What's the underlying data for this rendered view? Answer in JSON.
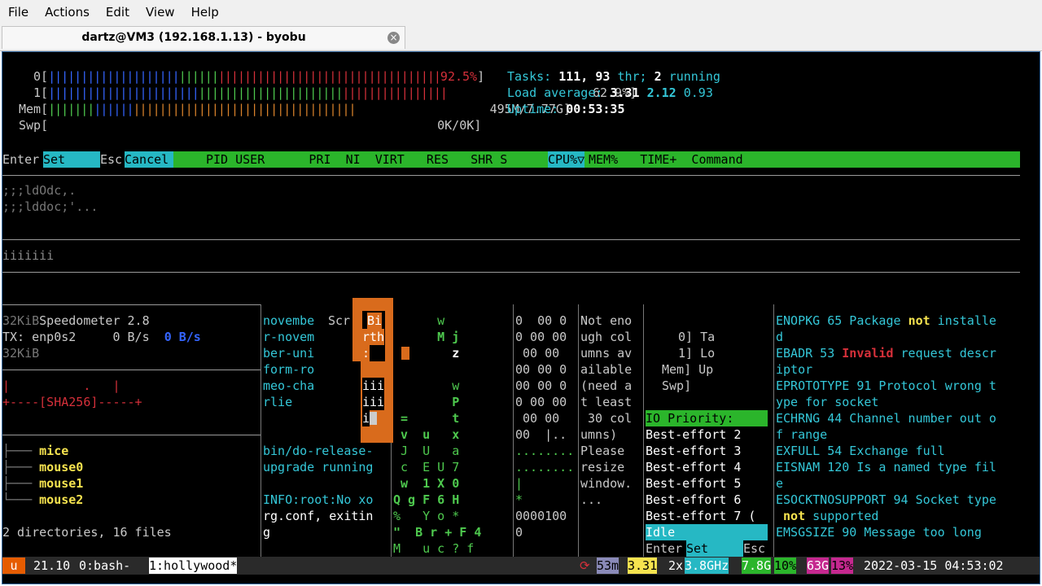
{
  "menu": [
    "File",
    "Actions",
    "Edit",
    "View",
    "Help"
  ],
  "tab": {
    "title": "dartz@VM3 (192.168.1.13) - byobu"
  },
  "htop": {
    "cpu0": {
      "label": "0[",
      "pct": "92.5%",
      "end": "]"
    },
    "cpu1": {
      "label": "1[",
      "pct": "62.9%",
      "end": "]"
    },
    "mem": {
      "label": "Mem[",
      "val": "495M/7.77G",
      "end": "]"
    },
    "swp": {
      "label": "Swp[",
      "val": "0K/0K",
      "end": "]"
    },
    "tasks_label": "Tasks:",
    "tasks_n": "111,",
    "thr_n": "93",
    "thr_label": "thr;",
    "running_n": "2",
    "running_label": "running",
    "load_label": "Load average:",
    "load1": "3.31",
    "load2": "2.12",
    "load3": "0.93",
    "uptime_label": "Uptime:",
    "uptime": "00:53:35",
    "header_enter": "Enter",
    "header_set": "Set",
    "header_esc": "Esc",
    "header_cancel": "Cancel",
    "header_cols": "PID USER      PRI  NI  VIRT   RES   SHR S",
    "header_cpu": "CPU%▽",
    "header_rest": "MEM%   TIME+  Command"
  },
  "art": {
    "line1": ";;;ldOdc,.",
    "line2": ";;;lddoc;'...",
    "line3": "iiiiiii"
  },
  "panes": {
    "speed": {
      "l1a": "32KiB",
      "l1b": "Speedometer 2.8",
      "l2a": "TX: enp0s2",
      "l2b": "0 B/s",
      "l2c": "0 B/s",
      "l3": "32KiB",
      "l4": "|          .   |",
      "l5": "+----[SHA256]-----+"
    },
    "tree": {
      "items": [
        "mice",
        "mouse0",
        "mouse1",
        "mouse2"
      ],
      "summary": "2 directories, 16 files"
    },
    "narrow": {
      "lines": [
        "novembe",
        "r-novem",
        "ber-uni",
        "form-ro",
        "meo-cha",
        "rlie"
      ]
    },
    "scr": {
      "label": "Scr"
    },
    "bird": {
      "l1": "Bi",
      "l2": "rth",
      "l3": ":",
      "l4": "iii",
      "l5": "iii",
      "l6": "i"
    },
    "release": {
      "lines": [
        "bin/do-release-",
        "upgrade running",
        "",
        "INFO:root:No xo",
        "rg.conf, exitin",
        "g"
      ]
    },
    "matrix": {
      "lines": [
        "      w  ",
        "      M j",
        "        z",
        "         ",
        "        w",
        "        P",
        " =      t",
        " v  u   x",
        " J  U   a",
        " c  E U 7",
        " w  1 X 0",
        "Q g F 6 H",
        "%   Y o *",
        "\"  B r + F 4",
        "M   u c ? f"
      ]
    },
    "hex": {
      "lines": [
        "0  00 0",
        "0 00 00",
        " 00 00",
        "00 00 0",
        "00 00 0",
        "0 00 00",
        " 00 00",
        "00  |..",
        "........",
        "........",
        "|",
        "*",
        "0000100",
        "0"
      ]
    },
    "msg": {
      "lines": [
        "Not eno",
        "ugh col",
        "umns av",
        "ailable",
        "(need a",
        "t least",
        " 30 col",
        "umns)",
        "Please",
        "resize",
        "window.",
        "..."
      ]
    },
    "mini": {
      "l1": "0] Ta",
      "l2": "1] Lo",
      "l3": "Mem] Up",
      "l4": "Swp]"
    },
    "io": {
      "title": "IO Priority:",
      "items": [
        "Best-effort 2",
        "Best-effort 3",
        "Best-effort 4",
        "Best-effort 5",
        "Best-effort 6",
        "Best-effort 7 ("
      ],
      "selected": "Idle",
      "enter": "Enter",
      "set": "Set",
      "esc": "Esc"
    },
    "errno": {
      "lines": [
        [
          {
            "t": "ENOPKG 65 Package ",
            "c": "cyan"
          },
          {
            "t": "not",
            "c": "yellow"
          },
          {
            "t": " installe",
            "c": "cyan"
          }
        ],
        [
          {
            "t": "d",
            "c": "cyan"
          }
        ],
        [
          {
            "t": "EBADR 53 ",
            "c": "cyan"
          },
          {
            "t": "Invalid",
            "c": "red"
          },
          {
            "t": " request descr",
            "c": "cyan"
          }
        ],
        [
          {
            "t": "iptor",
            "c": "cyan"
          }
        ],
        [
          {
            "t": "EPROTOTYPE 91 Protocol wrong t",
            "c": "cyan"
          }
        ],
        [
          {
            "t": "ype for socket",
            "c": "cyan"
          }
        ],
        [
          {
            "t": "ECHRNG 44 Channel number out o",
            "c": "cyan"
          }
        ],
        [
          {
            "t": "f range",
            "c": "cyan"
          }
        ],
        [
          {
            "t": "EXFULL 54 Exchange full",
            "c": "cyan"
          }
        ],
        [
          {
            "t": "EISNAM 120 Is a named type fil",
            "c": "cyan"
          }
        ],
        [
          {
            "t": "e",
            "c": "cyan"
          }
        ],
        [
          {
            "t": "ESOCKTNOSUPPORT 94 Socket type",
            "c": "cyan"
          }
        ],
        [
          {
            "t": " not",
            "c": "yellow"
          },
          {
            "t": " supported",
            "c": "cyan"
          }
        ],
        [
          {
            "t": "EMSGSIZE 90 Message too long",
            "c": "cyan"
          }
        ]
      ]
    }
  },
  "status": {
    "logo": "u",
    "version": "21.10",
    "win0": "0:bash-",
    "win1": "1:hollywood*",
    "updates": "53m",
    "load": "3.31",
    "cpu_count": "2x",
    "cpu_freq": "3.8GHz",
    "mem_total": "7.8G",
    "mem_pct": "10%",
    "disk": "63G",
    "disk_pct": "13%",
    "datetime": "2022-03-15 04:53:02"
  },
  "colors": {
    "header_bg": "#2bb52b",
    "select_bg": "#26b8c4",
    "orange_bird": "#d96b1c",
    "status_bg": "#2a2a2a"
  }
}
